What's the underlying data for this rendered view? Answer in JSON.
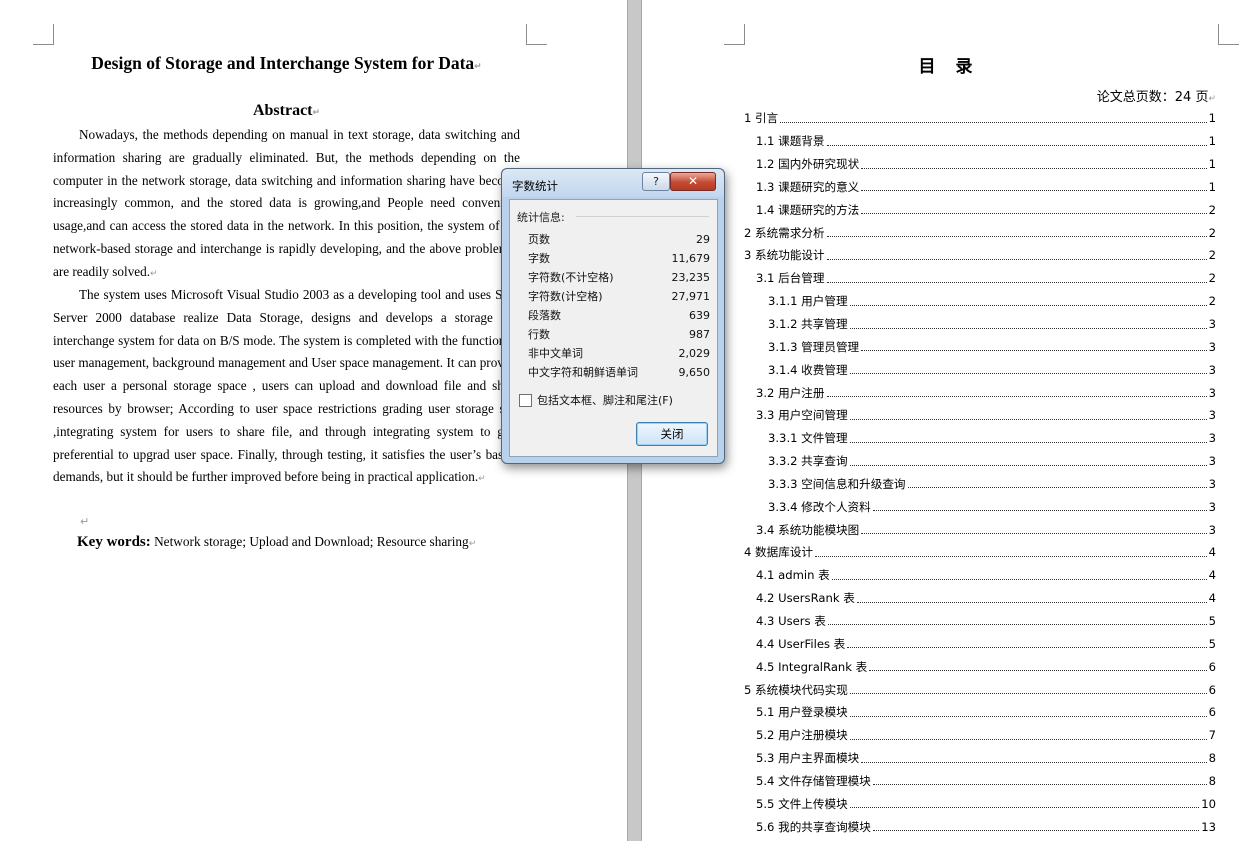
{
  "left_page": {
    "title": "Design of Storage and Interchange System for Data",
    "abstract_heading": "Abstract",
    "paragraph1": "Nowadays, the methods depending on manual in text storage, data switching and information sharing are gradually eliminated. But, the methods depending on the computer in the network storage, data switching and information sharing have become increasingly common, and the stored data is growing,and People need convenient usage,and can access the stored data in the network. In this position, the system of the network-based storage and interchange is rapidly developing, and the above problemes are readily solved.",
    "paragraph2": "The system uses Microsoft Visual Studio 2003 as a developing tool and uses SQL Server 2000 database realize Data Storage, designs and develops a storage and interchange system for data on B/S mode. The system is completed with the function of user management, background management and User space management. It can provide each user a personal storage space , users can upload and download file and share resources by browser; According to user space restrictions grading user storage size ,integrating system for users to share file, and through integrating system to give preferential to upgrad user space. Finally, through testing, it satisfies the user’s based-demands, but it should be further improved before being in practical application.",
    "keywords_label": "Key words:",
    "keywords": " Network storage; Upload and Download; Resource sharing"
  },
  "right_page": {
    "title": "目录",
    "total_pages": "论文总页数：24 页",
    "toc": [
      {
        "level": 1,
        "text": "1 引言",
        "page": "1"
      },
      {
        "level": 2,
        "text": "1.1 课题背景",
        "page": "1"
      },
      {
        "level": 2,
        "text": "1.2 国内外研究现状",
        "page": "1"
      },
      {
        "level": 2,
        "text": "1.3 课题研究的意义",
        "page": "1"
      },
      {
        "level": 2,
        "text": "1.4 课题研究的方法",
        "page": "2"
      },
      {
        "level": 1,
        "text": "2 系统需求分析",
        "page": "2"
      },
      {
        "level": 1,
        "text": "3 系统功能设计",
        "page": "2"
      },
      {
        "level": 2,
        "text": "3.1 后台管理",
        "page": "2"
      },
      {
        "level": 3,
        "text": "3.1.1 用户管理",
        "page": "2"
      },
      {
        "level": 3,
        "text": "3.1.2 共享管理",
        "page": "3"
      },
      {
        "level": 3,
        "text": "3.1.3 管理员管理",
        "page": "3"
      },
      {
        "level": 3,
        "text": "3.1.4 收费管理",
        "page": "3"
      },
      {
        "level": 2,
        "text": "3.2 用户注册",
        "page": "3"
      },
      {
        "level": 2,
        "text": "3.3 用户空间管理",
        "page": "3"
      },
      {
        "level": 3,
        "text": "3.3.1 文件管理",
        "page": "3"
      },
      {
        "level": 3,
        "text": "3.3.2 共享查询",
        "page": "3"
      },
      {
        "level": 3,
        "text": "3.3.3 空间信息和升级查询",
        "page": "3"
      },
      {
        "level": 3,
        "text": "3.3.4 修改个人资料",
        "page": "3"
      },
      {
        "level": 2,
        "text": "3.4 系统功能模块图",
        "page": "3"
      },
      {
        "level": 1,
        "text": "4 数据库设计",
        "page": "4"
      },
      {
        "level": 2,
        "text": "4.1 admin 表",
        "page": "4"
      },
      {
        "level": 2,
        "text": "4.2 UsersRank 表",
        "page": "4"
      },
      {
        "level": 2,
        "text": "4.3 Users 表",
        "page": "5"
      },
      {
        "level": 2,
        "text": "4.4 UserFiles 表",
        "page": "5"
      },
      {
        "level": 2,
        "text": "4.5 IntegralRank 表",
        "page": "6"
      },
      {
        "level": 1,
        "text": "5 系统模块代码实现",
        "page": "6"
      },
      {
        "level": 2,
        "text": "5.1 用户登录模块",
        "page": "6"
      },
      {
        "level": 2,
        "text": "5.2 用户注册模块",
        "page": "7"
      },
      {
        "level": 2,
        "text": "5.3 用户主界面模块",
        "page": "8"
      },
      {
        "level": 2,
        "text": "5.4 文件存储管理模块",
        "page": "8"
      },
      {
        "level": 2,
        "text": "5.5 文件上传模块",
        "page": "10"
      },
      {
        "level": 2,
        "text": "5.6 我的共享查询模块",
        "page": "13"
      }
    ]
  },
  "dialog": {
    "title": "字数统计",
    "help_label": "?",
    "close_x": "✕",
    "group_label": "统计信息:",
    "stats": [
      {
        "label": "页数",
        "value": "29"
      },
      {
        "label": "字数",
        "value": "11,679"
      },
      {
        "label": "字符数(不计空格)",
        "value": "23,235"
      },
      {
        "label": "字符数(计空格)",
        "value": "27,971"
      },
      {
        "label": "段落数",
        "value": "639"
      },
      {
        "label": "行数",
        "value": "987"
      },
      {
        "label": "非中文单词",
        "value": "2,029"
      },
      {
        "label": "中文字符和朝鲜语单词",
        "value": "9,650"
      }
    ],
    "checkbox_label": "包括文本框、脚注和尾注(F)",
    "close_button": "关闭"
  }
}
